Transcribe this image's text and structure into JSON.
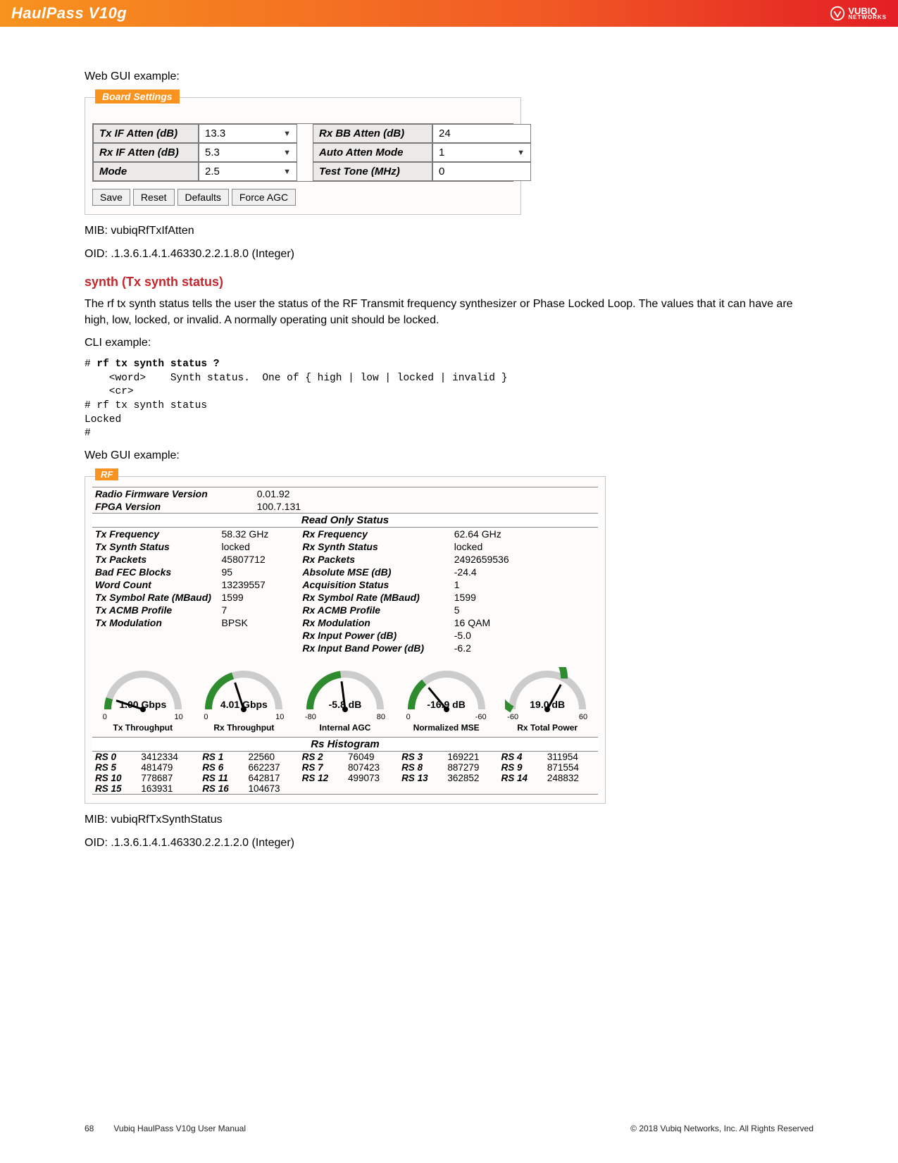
{
  "header": {
    "title": "HaulPass V10g",
    "logo_brand": "VUBIQ",
    "logo_sub": "NETWORKS"
  },
  "text": {
    "webgui_ex": "Web GUI example:",
    "mib1_pre": "MIB:  ",
    "mib1_val": "vubiqRfTxIfAtten",
    "oid1_pre": "OID:  ",
    "oid1_val": ".1.3.6.1.4.1.46330.2.2.1.8.0 (Integer)",
    "section_h": "synth (Tx synth status)",
    "section_p": "The rf tx synth status tells the user the status of the RF Transmit frequency synthesizer or Phase Locked Loop.  The values that it can have are high, low, locked, or invalid.  A normally operating unit should be locked.",
    "cli_ex": "CLI example:",
    "mib2_pre": "MIB:  ",
    "mib2_val": "vubiqRfTxSynthStatus",
    "oid2_pre": "OID:  ",
    "oid2_val": ".1.3.6.1.4.1.46330.2.2.1.2.0 (Integer)"
  },
  "cli": "# rf tx synth status ?\n    <word>    Synth status.  One of { high | low | locked | invalid }\n    <cr>\n# rf tx synth status\nLocked\n#",
  "cli_bold": "rf tx synth status ?",
  "board_settings": {
    "legend": "Board Settings",
    "rows": [
      {
        "l1": "Tx IF Atten (dB)",
        "v1": "13.3",
        "d1": true,
        "l2": "Rx BB Atten (dB)",
        "v2": "24",
        "d2": false
      },
      {
        "l1": "Rx IF Atten (dB)",
        "v1": "5.3",
        "d1": true,
        "l2": "Auto Atten Mode",
        "v2": "1",
        "d2": true
      },
      {
        "l1": "Mode",
        "v1": "2.5",
        "d1": true,
        "l2": "Test Tone (MHz)",
        "v2": "0",
        "d2": false
      }
    ],
    "buttons": [
      "Save",
      "Reset",
      "Defaults",
      "Force AGC"
    ]
  },
  "rf": {
    "legend": "RF",
    "top": [
      {
        "l": "Radio Firmware Version",
        "v": "0.01.92"
      },
      {
        "l": "FPGA Version",
        "v": "100.7.131"
      }
    ],
    "readonly_title": "Read Only Status",
    "rows": [
      {
        "l1": "Tx Frequency",
        "v1": "58.32 GHz",
        "l2": "Rx Frequency",
        "v2": "62.64 GHz"
      },
      {
        "l1": "Tx Synth Status",
        "v1": "locked",
        "l2": "Rx Synth Status",
        "v2": "locked"
      },
      {
        "l1": "Tx Packets",
        "v1": "45807712",
        "l2": "Rx Packets",
        "v2": "2492659536"
      },
      {
        "l1": "Bad FEC Blocks",
        "v1": "95",
        "l2": "Absolute MSE (dB)",
        "v2": "-24.4"
      },
      {
        "l1": "Word Count",
        "v1": "13239557",
        "l2": "Acquisition Status",
        "v2": "1"
      },
      {
        "l1": "Tx Symbol Rate (MBaud)",
        "v1": "1599",
        "l2": "Rx Symbol Rate (MBaud)",
        "v2": "1599"
      },
      {
        "l1": "Tx ACMB Profile",
        "v1": "7",
        "l2": "Rx ACMB Profile",
        "v2": "5"
      },
      {
        "l1": "Tx Modulation",
        "v1": "BPSK",
        "l2": "Rx Modulation",
        "v2": "16 QAM"
      },
      {
        "l1": "",
        "v1": "",
        "l2": "Rx Input Power (dB)",
        "v2": "-5.0"
      },
      {
        "l1": "",
        "v1": "",
        "l2": "Rx Input Band Power (dB)",
        "v2": "-6.2"
      }
    ],
    "gauges": [
      {
        "val": "1.00 Gbps",
        "lo": "0",
        "hi": "10",
        "name": "Tx Throughput",
        "frac": 0.1
      },
      {
        "val": "4.01 Gbps",
        "lo": "0",
        "hi": "10",
        "name": "Rx Throughput",
        "frac": 0.4
      },
      {
        "val": "-5.8 dB",
        "lo": "-80",
        "hi": "80",
        "name": "Internal AGC",
        "frac": 0.46
      },
      {
        "val": "-16.9 dB",
        "lo": "0",
        "hi": "-60",
        "name": "Normalized MSE",
        "frac": 0.28
      },
      {
        "val": "19.0 dB",
        "lo": "-60",
        "hi": "60",
        "name": "Rx Total Power",
        "frac": 0.66
      }
    ],
    "hist_title": "Rs Histogram",
    "hist": [
      [
        [
          "RS 0",
          "3412334"
        ],
        [
          "RS 1",
          "22560"
        ],
        [
          "RS 2",
          "76049"
        ],
        [
          "RS 3",
          "169221"
        ],
        [
          "RS 4",
          "311954"
        ]
      ],
      [
        [
          "RS 5",
          "481479"
        ],
        [
          "RS 6",
          "662237"
        ],
        [
          "RS 7",
          "807423"
        ],
        [
          "RS 8",
          "887279"
        ],
        [
          "RS 9",
          "871554"
        ]
      ],
      [
        [
          "RS 10",
          "778687"
        ],
        [
          "RS 11",
          "642817"
        ],
        [
          "RS 12",
          "499073"
        ],
        [
          "RS 13",
          "362852"
        ],
        [
          "RS 14",
          "248832"
        ]
      ],
      [
        [
          "RS 15",
          "163931"
        ],
        [
          "RS 16",
          "104673"
        ],
        [
          "",
          ""
        ],
        [
          "",
          ""
        ],
        [
          "",
          ""
        ]
      ]
    ]
  },
  "footer": {
    "page": "68",
    "doc": "Vubiq HaulPass V10g User Manual",
    "copyright": "© 2018 Vubiq Networks, Inc. All Rights Reserved"
  }
}
